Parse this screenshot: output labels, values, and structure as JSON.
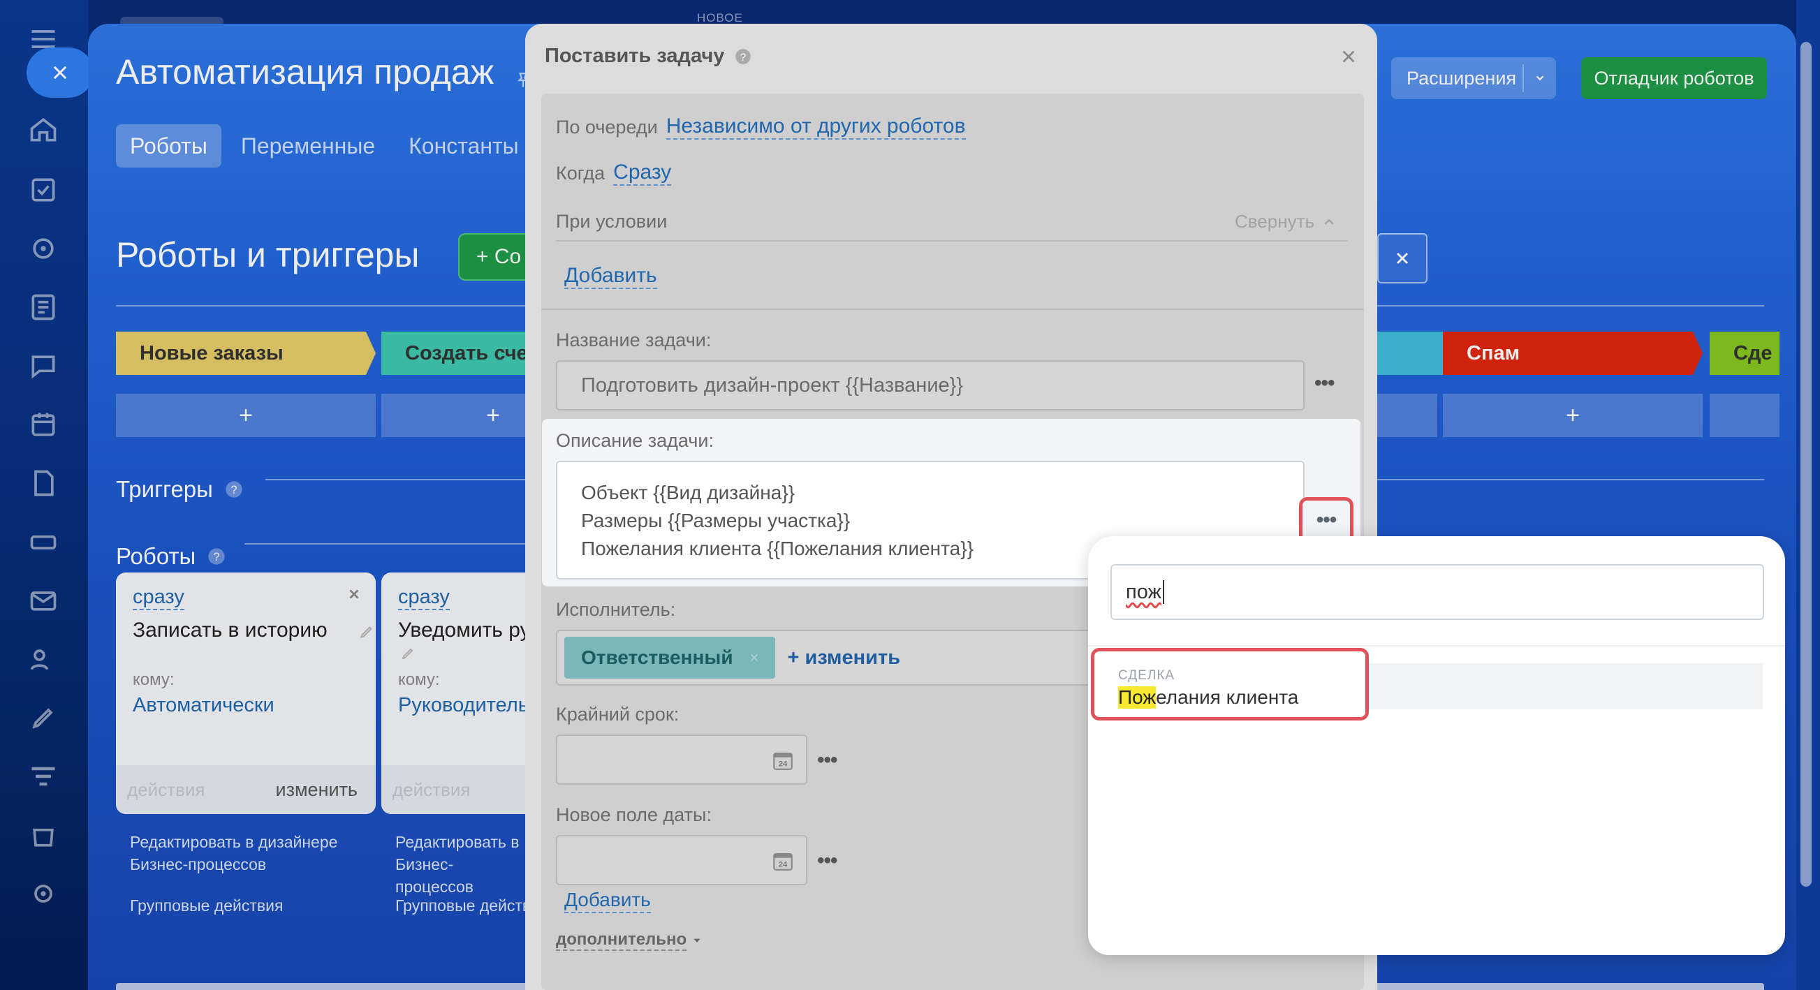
{
  "app": {
    "title": "Автоматизация продаж",
    "tabs": [
      "Роботы",
      "Переменные",
      "Константы"
    ],
    "top_label": "НОВОЕ",
    "extensions_label": "Расширения",
    "debugger_label": "Отладчик роботов"
  },
  "section": {
    "title": "Роботы и триггеры",
    "create_label": "+ Со",
    "triggers_label": "Триггеры",
    "robots_label": "Роботы"
  },
  "stages": [
    {
      "name": "Новые заказы",
      "color": "#e6cd6a"
    },
    {
      "name": "Создать счет",
      "color": "#3fc9b0"
    },
    {
      "name": "",
      "color": "#3fbcd8"
    },
    {
      "name": "Спам",
      "color": "#e0260e"
    },
    {
      "name": "Сде",
      "color": "#86c621"
    }
  ],
  "plus_symbol": "+",
  "robot_cards": [
    {
      "when": "сразу",
      "name": "Записать в историю",
      "to_label": "кому:",
      "to_value": "Автоматически",
      "actions_label": "действия",
      "edit_label": "изменить"
    },
    {
      "when": "сразу",
      "name": "Уведомить ру",
      "to_label": "кому:",
      "to_value": "Руководитель",
      "actions_label": "действия",
      "edit_label": ""
    }
  ],
  "card_links": [
    {
      "designer": "Редактировать в дизайнере Бизнес-процессов",
      "group": "Групповые действия"
    },
    {
      "designer": "Редактировать в Бизнес-процессов",
      "group": "Групповые действ"
    }
  ],
  "dialog": {
    "title": "Поставить задачу",
    "queue_label": "По очереди",
    "queue_value": "Независимо от других роботов",
    "when_label": "Когда",
    "when_value": "Сразу",
    "condition_label": "При условии",
    "collapse_label": "Свернуть",
    "add_label": "Добавить",
    "task_name_label": "Название задачи:",
    "task_name_value": "Подготовить дизайн-проект {{Название}}",
    "description_label": "Описание задачи:",
    "description_lines": [
      "Объект {{Вид дизайна}}",
      "Размеры {{Размеры участка}}",
      "Пожелания клиента {{Пожелания клиента}}"
    ],
    "assignee_label": "Исполнитель:",
    "assignee_tag": "Ответственный",
    "assignee_change": "+ изменить",
    "deadline_label": "Крайний срок:",
    "new_date_label": "Новое поле даты:",
    "calendar_day": "24",
    "add_field_label": "Добавить",
    "more_label": "дополнительно"
  },
  "popup": {
    "search_value": "пож",
    "result_category": "СДЕЛКА",
    "result_highlight": "Пож",
    "result_rest": "елания клиента"
  },
  "colors": {
    "brand_blue": "#2467dc",
    "link_blue": "#2067b0",
    "green_button": "#1f9a48",
    "highlight_ring": "#e0525a",
    "search_match": "#f6e930"
  }
}
